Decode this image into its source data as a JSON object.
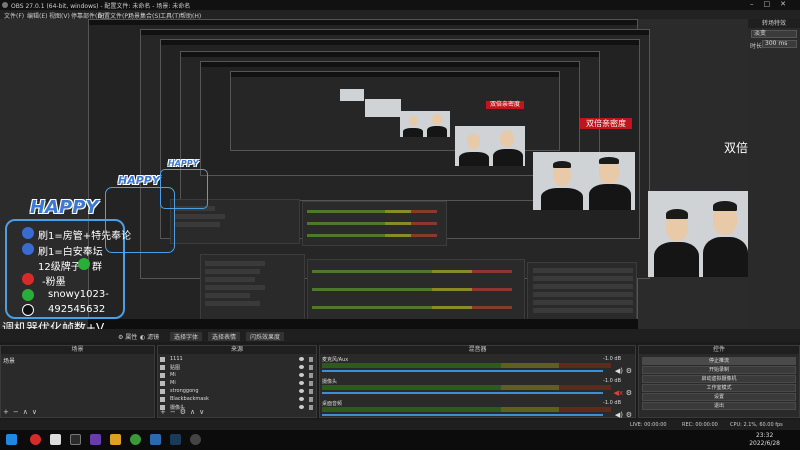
{
  "window": {
    "title": "OBS 27.0.1 (64-bit, windows) - 配置文件: 未命名 - 场景: 未命名"
  },
  "menubar": {
    "items": [
      "文件(F)",
      "编辑(E)",
      "视图(V)",
      "停靠部件(D)",
      "配置文件(P)",
      "场景集合(S)",
      "工具(T)",
      "帮助(H)"
    ]
  },
  "preview": {
    "label_large": "双倍亲密度",
    "label_mid": "双倍亲密度",
    "label_small": "双倍亲密度",
    "overlay": {
      "happy": "HAPPY",
      "line1": "刷1=房管+特先奉论",
      "line2": "刷1=白安奉坛",
      "line3": "12级牌子",
      "line3b": "群",
      "line4": "-粉墨",
      "line5": "snowy1023-",
      "line6": "492545632",
      "footer": "调机器优化帧数+V"
    }
  },
  "sidepanel": {
    "header": "转场特效",
    "transition": "淡变",
    "duration_label": "时长",
    "duration_value": "300 ms"
  },
  "transbar": {
    "items": [
      "属性",
      "滤镜",
      "选择字体",
      "选择表情",
      "闪烁效果度"
    ]
  },
  "scenes": {
    "header": "场景",
    "items": [
      "场景"
    ]
  },
  "sources": {
    "header": "来源",
    "items": [
      "1111",
      "贴图",
      "Mi",
      "Mi",
      "stronggong",
      "Blackbackmask",
      "摄像头"
    ]
  },
  "mixer": {
    "header": "混音器",
    "channels": [
      {
        "name": "麦克风/Aux",
        "db": "-1.0 dB"
      },
      {
        "name": "摄像头",
        "db": "-1.0 dB"
      },
      {
        "name": "桌面音频",
        "db": "-1.0 dB"
      }
    ]
  },
  "controls": {
    "header": "控件",
    "buttons": [
      "停止推流",
      "开始录制",
      "启动虚拟摄像机",
      "工作室模式",
      "设置",
      "退出"
    ]
  },
  "status": {
    "live": "LIVE: 00:00:00",
    "rec": "REC: 00:00:00",
    "cpu": "CPU: 2.1%, 60.00 fps"
  },
  "taskbar": {
    "time": "23:32",
    "date": "2022/6/28"
  },
  "colors": {
    "accent_red": "#c0151b",
    "overlay_blue": "#3b79d6"
  }
}
